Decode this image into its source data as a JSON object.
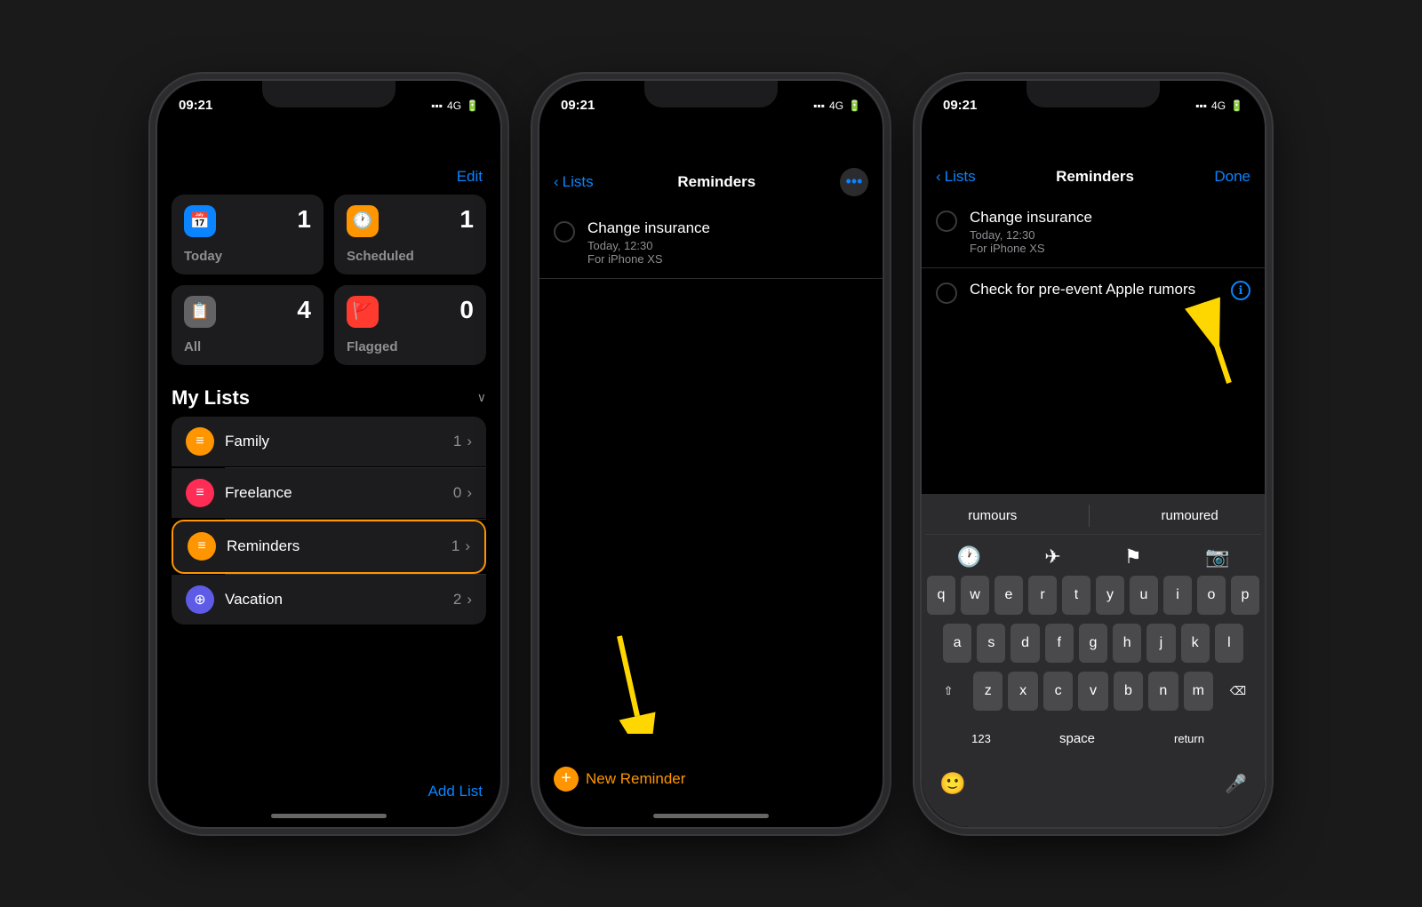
{
  "colors": {
    "accent": "#0a84ff",
    "orange": "#ff9500",
    "background": "#000000",
    "card": "#1c1c1e",
    "separator": "#2c2c2e",
    "text_primary": "#ffffff",
    "text_secondary": "#8e8e93",
    "yellow_arrow": "#ffd700"
  },
  "phone1": {
    "status_time": "09:21",
    "header_button": "Edit",
    "cards": [
      {
        "icon": "📅",
        "icon_color": "blue",
        "count": "1",
        "label": "Today"
      },
      {
        "icon": "🕐",
        "icon_color": "orange",
        "count": "1",
        "label": "Scheduled"
      },
      {
        "icon": "📋",
        "icon_color": "gray",
        "count": "4",
        "label": "All"
      },
      {
        "icon": "🚩",
        "icon_color": "red",
        "count": "0",
        "label": "Flagged"
      }
    ],
    "section_title": "My Lists",
    "lists": [
      {
        "icon": "≡",
        "icon_color": "orange",
        "name": "Family",
        "count": "1",
        "highlighted": false
      },
      {
        "icon": "≡",
        "icon_color": "pink",
        "name": "Freelance",
        "count": "0",
        "highlighted": false
      },
      {
        "icon": "≡",
        "icon_color": "orange",
        "name": "Reminders",
        "count": "1",
        "highlighted": true
      },
      {
        "icon": "⊕",
        "icon_color": "purple",
        "name": "Vacation",
        "count": "2",
        "highlighted": false
      }
    ],
    "add_list_label": "Add List"
  },
  "phone2": {
    "status_time": "09:21",
    "nav_back": "Lists",
    "nav_title": "Reminders",
    "reminder": {
      "title": "Change insurance",
      "subtitle1": "Today, 12:30",
      "subtitle2": "For iPhone XS"
    },
    "new_reminder_label": "New Reminder"
  },
  "phone3": {
    "status_time": "09:21",
    "nav_back": "Lists",
    "nav_title": "Reminders",
    "nav_done": "Done",
    "reminders": [
      {
        "title": "Change insurance",
        "subtitle1": "Today, 12:30",
        "subtitle2": "For iPhone XS",
        "has_info": false
      },
      {
        "title": "Check for pre-event Apple rumors",
        "subtitle1": "",
        "subtitle2": "",
        "has_info": true
      }
    ],
    "autocomplete": [
      "rumours",
      "rumoured"
    ],
    "toolbar_icons": [
      "clock",
      "location",
      "flag",
      "camera"
    ],
    "keyboard_rows": [
      [
        "q",
        "w",
        "e",
        "r",
        "t",
        "y",
        "u",
        "i",
        "o",
        "p"
      ],
      [
        "a",
        "s",
        "d",
        "f",
        "g",
        "h",
        "j",
        "k",
        "l"
      ],
      [
        "z",
        "x",
        "c",
        "v",
        "b",
        "n",
        "m"
      ]
    ],
    "special_keys": {
      "shift": "⇧",
      "delete": "⌫",
      "numbers": "123",
      "space": "space",
      "return": "return"
    }
  }
}
